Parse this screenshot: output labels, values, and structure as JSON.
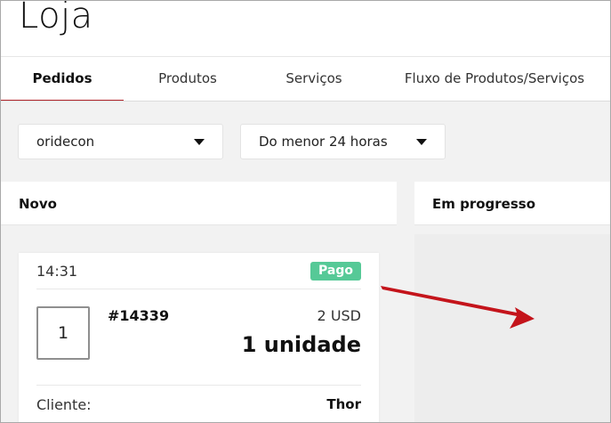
{
  "app": {
    "title": "Loja"
  },
  "tabs": [
    {
      "label": "Pedidos",
      "active": true
    },
    {
      "label": "Produtos",
      "active": false
    },
    {
      "label": "Serviços",
      "active": false
    },
    {
      "label": "Fluxo de Produtos/Serviços",
      "active": false
    }
  ],
  "filters": {
    "store": {
      "value": "oridecon"
    },
    "time": {
      "value": "Do menor 24 horas"
    }
  },
  "columns": [
    {
      "title": "Novo"
    },
    {
      "title": "Em progresso"
    }
  ],
  "order": {
    "time": "14:31",
    "status": "Pago",
    "quantity": "1",
    "number": "#14339",
    "price": "2 USD",
    "units": "1 unidade",
    "client_label": "Cliente:",
    "client_name": "Thor"
  },
  "colors": {
    "accent": "#b3262d",
    "paid_badge": "#56c997",
    "arrow": "#c4141b"
  },
  "icons": {
    "dropdown": "chevron-down-icon",
    "annotation": "arrow-icon"
  }
}
